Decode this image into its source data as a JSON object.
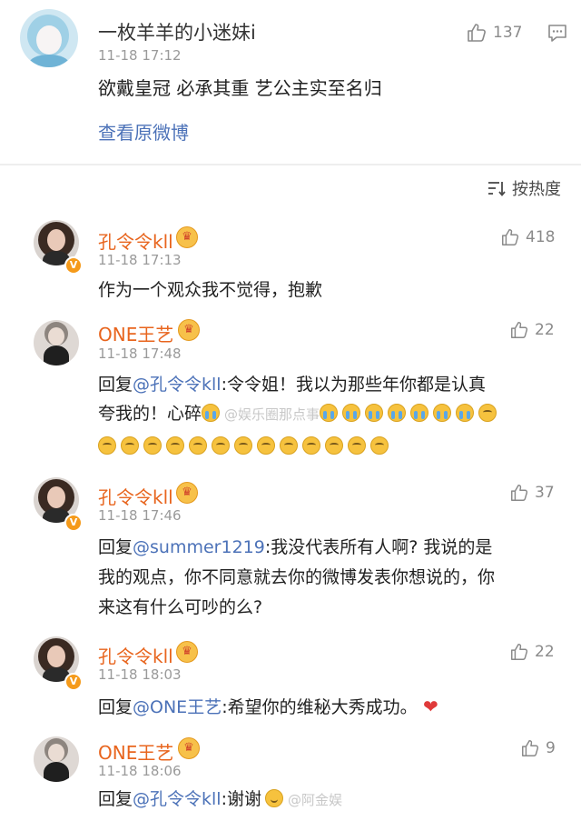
{
  "post": {
    "author": "一枚羊羊的小迷妹i",
    "time": "11-18 17:12",
    "likes": "137",
    "text": "欲戴皇冠 必承其重 艺公主实至名归",
    "view_original": "查看原微博"
  },
  "sort": {
    "label": "按热度"
  },
  "comments": [
    {
      "author": "孔令令kll",
      "time": "11-18 17:13",
      "likes": "418",
      "lines": [
        "作为一个观众我不觉得，抱歉"
      ]
    },
    {
      "author": "ONE王艺",
      "time": "11-18 17:48",
      "likes": "22",
      "reply_prefix": "回复",
      "mention": "@孔令令kll",
      "line1_rest": ":令令姐！我以为那些年你都是认真",
      "line2": "夸我的！心碎",
      "watermark": "@娱乐圈那点事"
    },
    {
      "author": "孔令令kll",
      "time": "11-18 17:46",
      "likes": "37",
      "reply_prefix": "回复",
      "mention": "@summer1219",
      "line1_rest": ":我没代表所有人啊? 我说的是",
      "line2": "我的观点，你不同意就去你的微博发表你想说的，你",
      "line3": "来这有什么可吵的么?"
    },
    {
      "author": "孔令令kll",
      "time": "11-18 18:03",
      "likes": "22",
      "reply_prefix": "回复",
      "mention": "@ONE王艺",
      "line1_rest": ":希望你的维秘大秀成功。"
    },
    {
      "author": "ONE王艺",
      "time": "11-18 18:06",
      "likes": "9",
      "reply_prefix": "回复",
      "mention": "@孔令令kll",
      "line1_rest": ":谢谢",
      "watermark": "@阿金娱"
    }
  ],
  "icons": {
    "like": "thumbs-up-icon",
    "comment": "comment-icon",
    "sort": "sort-icon",
    "verified": "verified-badge-icon",
    "crown": "vip-crown-icon"
  },
  "colors": {
    "link": "#4c72b8",
    "name_vip": "#e8651e",
    "meta": "#9a9a9a",
    "badge": "#f59a1a"
  }
}
